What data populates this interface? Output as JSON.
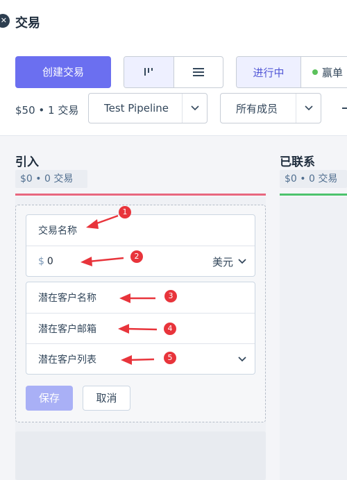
{
  "header": {
    "title": "交易",
    "create_button": "创建交易",
    "status_tabs": {
      "active": "进行中",
      "won": "赢单"
    },
    "summary": "$50 • 1 交易",
    "pipeline_select": "Test Pipeline",
    "members_select": "所有成员"
  },
  "columns": [
    {
      "title": "引入",
      "stat": "$0 • 0 交易",
      "color": "#e8677f"
    },
    {
      "title": "已联系",
      "stat": "$0 • 0 交易",
      "color": "#4cc36d"
    }
  ],
  "form": {
    "deal_name_placeholder": "交易名称",
    "currency_symbol": "$",
    "amount_value": "0",
    "currency_label": "美元",
    "prospect_name_placeholder": "潜在客户名称",
    "prospect_email_placeholder": "潜在客户邮箱",
    "prospect_list_placeholder": "潜在客户列表",
    "save_label": "保存",
    "cancel_label": "取消"
  },
  "annotations": [
    "1",
    "2",
    "3",
    "4",
    "5"
  ],
  "colors": {
    "accent": "#6b6ff0",
    "annotation": "#e8343b"
  }
}
